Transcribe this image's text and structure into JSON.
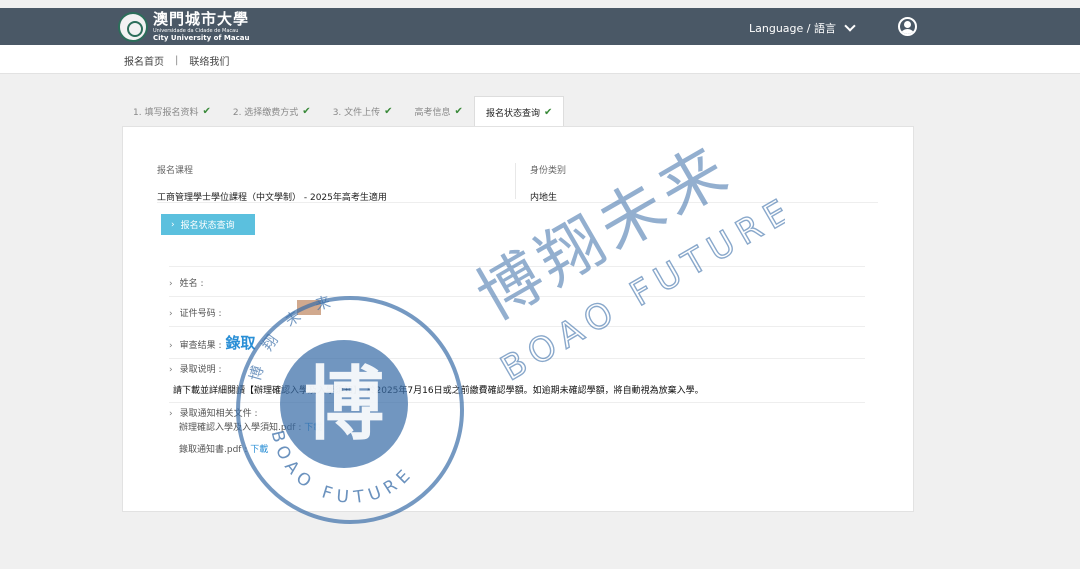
{
  "header": {
    "logo_cn": "澳門城市大學",
    "logo_pt": "Universidade da Cidade de Macau",
    "logo_en": "City University of Macau",
    "language_label": "Language / 語言"
  },
  "subnav": {
    "home": "报名首页",
    "separator": "|",
    "contact": "联络我们"
  },
  "tabs": [
    {
      "label": "1. 填写报名资料",
      "done": true
    },
    {
      "label": "2. 选择缴费方式",
      "done": true
    },
    {
      "label": "3. 文件上传",
      "done": true
    },
    {
      "label": "高考信息",
      "done": true
    },
    {
      "label": "报名状态查询",
      "done": true,
      "active": true
    }
  ],
  "check_glyph": "✔",
  "application": {
    "program_label": "报名课程",
    "program_value": "工商管理學士學位課程（中文學制） - 2025年高考生適用",
    "identity_label": "身份类别",
    "identity_value": "内地生"
  },
  "status_button": "报名状态查询",
  "details": {
    "name_label": "姓名 :",
    "id_label": "证件号码 :",
    "result_label": "审查结果 :",
    "result_value": "錄取",
    "notes_label": "录取说明 :",
    "notes_text": "請下載並詳細閱讀【辦理確認入學及入學須知】，於2025年7月16日或之前繳費確認學額。如逾期未確認學額，將自動視為放棄入學。",
    "docs_label": "录取通知相关文件 :",
    "files": [
      {
        "name": "辦理確認入學及入學須知.pdf :",
        "link": "下載"
      },
      {
        "name": "錄取通知書.pdf :",
        "link": "下載"
      }
    ]
  },
  "watermark": {
    "cn": "博翔未来",
    "en": "BOAO FUTURE",
    "seal_char": "博",
    "seal_small": "博 翔 未 来"
  },
  "colors": {
    "header_bg": "#4a5866",
    "accent_button": "#5bc0de",
    "link": "#2a8fd6",
    "check": "#3a8a3a",
    "watermark": "#3a6ea8"
  }
}
